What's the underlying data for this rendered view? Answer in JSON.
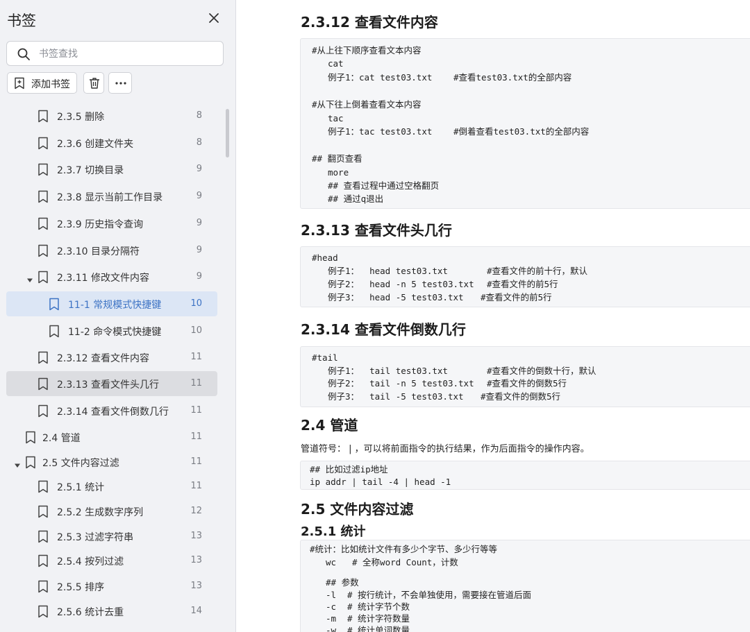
{
  "sidebar": {
    "title": "书签",
    "search_placeholder": "书签查找",
    "add_label": "添加书签",
    "items": [
      {
        "label": "2.3.5 删除",
        "page": "8"
      },
      {
        "label": "2.3.6 创建文件夹",
        "page": "8"
      },
      {
        "label": "2.3.7 切换目录",
        "page": "9"
      },
      {
        "label": "2.3.8 显示当前工作目录",
        "page": "9"
      },
      {
        "label": "2.3.9 历史指令查询",
        "page": "9"
      },
      {
        "label": "2.3.10 目录分隔符",
        "page": "9"
      },
      {
        "label": "2.3.11 修改文件内容",
        "page": "9"
      },
      {
        "label": "11-1 常规模式快捷键",
        "page": "10"
      },
      {
        "label": "11-2 命令模式快捷键",
        "page": "10"
      },
      {
        "label": "2.3.12 查看文件内容",
        "page": "11"
      },
      {
        "label": "2.3.13 查看文件头几行",
        "page": "11"
      },
      {
        "label": "2.3.14 查看文件倒数几行",
        "page": "11"
      },
      {
        "label": "2.4 管道",
        "page": "11"
      },
      {
        "label": "2.5 文件内容过滤",
        "page": "11"
      },
      {
        "label": "2.5.1 统计",
        "page": "11"
      },
      {
        "label": "2.5.2 生成数字序列",
        "page": "12"
      },
      {
        "label": "2.5.3 过滤字符串",
        "page": "13"
      },
      {
        "label": "2.5.4 按列过滤",
        "page": "13"
      },
      {
        "label": "2.5.5 排序",
        "page": "13"
      },
      {
        "label": "2.5.6 统计去重",
        "page": "14"
      }
    ]
  },
  "doc": {
    "h_2312": "2.3.12 查看文件内容",
    "code_2312": [
      "#从上往下顺序查看文本内容",
      "cat",
      "例子1：cat test03.txt",
      "#查看test03.txt的全部内容",
      "#从下往上倒着查看文本内容",
      "tac",
      "例子1：tac test03.txt",
      "#倒着查看test03.txt的全部内容",
      "## 翻页查看",
      "more",
      "## 查看过程中通过空格翻页",
      "## 通过q退出"
    ],
    "h_2313": "2.3.13 查看文件头几行",
    "code_2313": [
      "#head",
      "例子1：  head test03.txt",
      "#查看文件的前十行，默认",
      "例子2：  head -n 5 test03.txt",
      "#查看文件的前5行",
      "例子3：  head -5 test03.txt",
      "#查看文件的前5行"
    ],
    "h_2314": "2.3.14 查看文件倒数几行",
    "code_2314": [
      "#tail",
      "例子1：  tail test03.txt",
      "#查看文件的倒数十行，默认",
      "例子2：  tail -n 5 test03.txt",
      "#查看文件的倒数5行",
      "例子3：  tail -5 test03.txt",
      "#查看文件的倒数5行"
    ],
    "h_24": "2.4 管道",
    "para_24": "管道符号：  | ，可以将前面指令的执行结果，作为后面指令的操作内容。",
    "code_24": [
      "## 比如过滤ip地址",
      "ip addr | tail -4 | head -1"
    ],
    "h_25": "2.5 文件内容过滤",
    "h_251": "2.5.1 统计",
    "code_251": [
      "#统计：比如统计文件有多少个字节、多少行等等",
      "wc",
      "# 全称word Count，计数",
      "## 参数",
      "-l",
      "# 按行统计，不会单独使用，需要接在管道后面",
      "-c",
      "# 统计字节个数",
      "-m",
      "# 统计字符数量",
      "-w",
      "# 统计单词数量"
    ]
  },
  "colors": {
    "comment": "#2a5db0",
    "selected_blue_bg": "#dce6f5",
    "selected_gray_bg": "#dcdde1",
    "sidebar_bg": "#f1f2f5",
    "code_bg": "#f5f6f8"
  }
}
